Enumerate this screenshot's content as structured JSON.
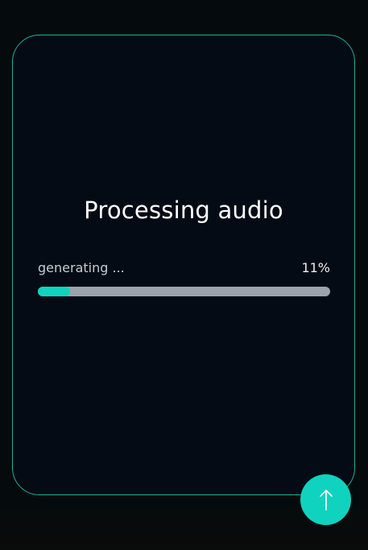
{
  "card": {
    "title": "Processing audio",
    "status_text": "generating ...",
    "progress": {
      "percent_label": "11%",
      "fraction": 0.11
    }
  },
  "fab": {
    "icon": "arrow-up-icon"
  },
  "colors": {
    "accent": "#0fd3bf",
    "card_border": "#1fae99",
    "card_background": "#040b14",
    "page_background": "#050b0c",
    "track": "#9ca3ad"
  }
}
